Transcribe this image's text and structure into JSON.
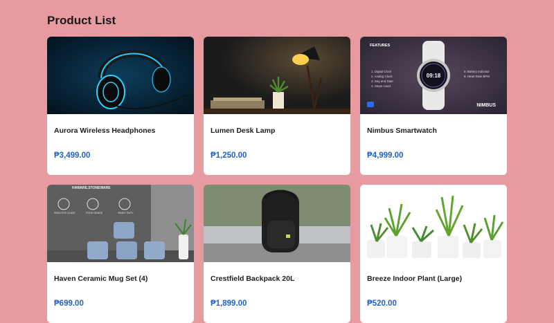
{
  "page": {
    "title": "Product List"
  },
  "products": [
    {
      "name": "Aurora Wireless Headphones",
      "price": "₱3,499.00",
      "image": "headphones-image"
    },
    {
      "name": "Lumen Desk Lamp",
      "price": "₱1,250.00",
      "image": "desk-lamp-image"
    },
    {
      "name": "Nimbus Smartwatch",
      "price": "₱4,999.00",
      "image": "smartwatch-image",
      "image_text": {
        "heading": "FEATURES",
        "features_left": [
          "1. Digital Clock",
          "2. Analog Clock",
          "3. Day and Date",
          "4. Steps count"
        ],
        "features_right": [
          "5. Battery Indicator",
          "6. Heart Rate BPM"
        ],
        "brand": "NIMBUS",
        "watch_time": "09:18"
      }
    },
    {
      "name": "Haven Ceramic Mug Set (4)",
      "price": "₱699.00",
      "image": "mug-set-image",
      "image_text": {
        "brand": "HAWARE.STONEWARE",
        "badges": [
          "REACTIVE GLAZE",
          "FOOD GRADE",
          "HEAVY DUTY"
        ]
      }
    },
    {
      "name": "Crestfield Backpack 20L",
      "price": "₱1,899.00",
      "image": "backpack-image"
    },
    {
      "name": "Breeze Indoor Plant (Large)",
      "price": "₱520.00",
      "image": "plants-image"
    }
  ],
  "colors": {
    "background": "#e89aa1",
    "card": "#ffffff",
    "price": "#1f63c4",
    "title": "#1a1a1a"
  }
}
